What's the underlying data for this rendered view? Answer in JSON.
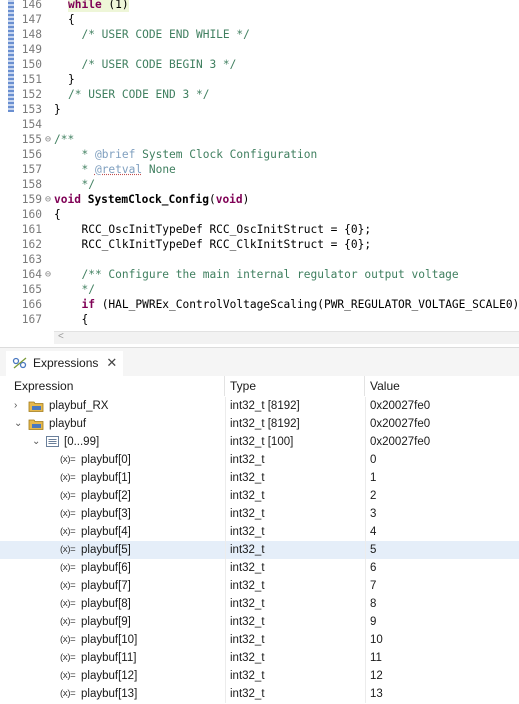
{
  "editor": {
    "lines": [
      {
        "n": "146",
        "fold": "",
        "segs": [
          [
            "kw",
            "while"
          ],
          [
            "pl",
            " (1)"
          ]
        ],
        "hl": true
      },
      {
        "n": "147",
        "fold": "",
        "segs": [
          [
            "pl",
            "{"
          ]
        ]
      },
      {
        "n": "148",
        "fold": "",
        "segs": [
          [
            "cm",
            "  /* USER CODE END WHILE */"
          ]
        ]
      },
      {
        "n": "149",
        "fold": "",
        "segs": []
      },
      {
        "n": "150",
        "fold": "",
        "segs": [
          [
            "cm",
            "  /* USER CODE BEGIN 3 */"
          ]
        ]
      },
      {
        "n": "151",
        "fold": "",
        "segs": [
          [
            "pl",
            "}"
          ]
        ]
      },
      {
        "n": "152",
        "fold": "",
        "segs": [
          [
            "cm",
            "/* USER CODE END 3 */"
          ]
        ]
      },
      {
        "n": "153",
        "fold": "",
        "segs": [
          [
            "pl",
            "}"
          ]
        ],
        "indent": -1
      },
      {
        "n": "154",
        "fold": "",
        "segs": []
      },
      {
        "n": "155",
        "fold": "⊖",
        "segs": [
          [
            "cm",
            "/**"
          ]
        ],
        "indent": -1
      },
      {
        "n": "156",
        "fold": "",
        "segs": [
          [
            "cm",
            "  * "
          ],
          [
            "tag",
            "@brief"
          ],
          [
            "cm",
            " System Clock Configuration"
          ]
        ]
      },
      {
        "n": "157",
        "fold": "",
        "segs": [
          [
            "cm",
            "  * "
          ],
          [
            "tagu",
            "@retval"
          ],
          [
            "cm",
            " None"
          ]
        ]
      },
      {
        "n": "158",
        "fold": "",
        "segs": [
          [
            "cm",
            "  */"
          ]
        ]
      },
      {
        "n": "159",
        "fold": "⊖",
        "segs": [
          [
            "kw",
            "void"
          ],
          [
            "pl",
            " "
          ],
          [
            "fn",
            "SystemClock_Config"
          ],
          [
            "pl",
            "("
          ],
          [
            "kw",
            "void"
          ],
          [
            "pl",
            ")"
          ]
        ],
        "indent": -1
      },
      {
        "n": "160",
        "fold": "",
        "segs": [
          [
            "pl",
            "{"
          ]
        ],
        "indent": -1
      },
      {
        "n": "161",
        "fold": "",
        "segs": [
          [
            "pl",
            "  RCC_OscInitTypeDef RCC_OscInitStruct = {0};"
          ]
        ]
      },
      {
        "n": "162",
        "fold": "",
        "segs": [
          [
            "pl",
            "  RCC_ClkInitTypeDef RCC_ClkInitStruct = {0};"
          ]
        ]
      },
      {
        "n": "163",
        "fold": "",
        "segs": []
      },
      {
        "n": "164",
        "fold": "⊖",
        "segs": [
          [
            "cm",
            "  /** Configure the main internal regulator output voltage"
          ]
        ]
      },
      {
        "n": "165",
        "fold": "",
        "segs": [
          [
            "cm",
            "  */"
          ]
        ]
      },
      {
        "n": "166",
        "fold": "",
        "segs": [
          [
            "kw",
            "  if"
          ],
          [
            "pl",
            " (HAL_PWREx_ControlVoltageScaling(PWR_REGULATOR_VOLTAGE_SCALE0)"
          ]
        ]
      },
      {
        "n": "167",
        "fold": "",
        "segs": [
          [
            "pl",
            "  {"
          ]
        ]
      }
    ],
    "hscroll_arrow": "<"
  },
  "view": {
    "tab_label": "Expressions",
    "close_glyph": "✕"
  },
  "table": {
    "headers": [
      "Expression",
      "Type",
      "Value"
    ],
    "rows": [
      {
        "level": 0,
        "chev": "›",
        "icon": "folder",
        "expr": "playbuf_RX",
        "type": "int32_t [8192]",
        "value": "0x20027fe0"
      },
      {
        "level": 0,
        "chev": "⌄",
        "icon": "folder",
        "expr": "playbuf",
        "type": "int32_t [8192]",
        "value": "0x20027fe0"
      },
      {
        "level": 1,
        "chev": "⌄",
        "icon": "array",
        "expr": "[0...99]",
        "type": "int32_t [100]",
        "value": "0x20027fe0"
      },
      {
        "level": 2,
        "icon": "var",
        "expr": "playbuf[0]",
        "type": "int32_t",
        "value": "0"
      },
      {
        "level": 2,
        "icon": "var",
        "expr": "playbuf[1]",
        "type": "int32_t",
        "value": "1"
      },
      {
        "level": 2,
        "icon": "var",
        "expr": "playbuf[2]",
        "type": "int32_t",
        "value": "2"
      },
      {
        "level": 2,
        "icon": "var",
        "expr": "playbuf[3]",
        "type": "int32_t",
        "value": "3"
      },
      {
        "level": 2,
        "icon": "var",
        "expr": "playbuf[4]",
        "type": "int32_t",
        "value": "4"
      },
      {
        "level": 2,
        "icon": "var",
        "expr": "playbuf[5]",
        "type": "int32_t",
        "value": "5",
        "selected": true
      },
      {
        "level": 2,
        "icon": "var",
        "expr": "playbuf[6]",
        "type": "int32_t",
        "value": "6"
      },
      {
        "level": 2,
        "icon": "var",
        "expr": "playbuf[7]",
        "type": "int32_t",
        "value": "7"
      },
      {
        "level": 2,
        "icon": "var",
        "expr": "playbuf[8]",
        "type": "int32_t",
        "value": "8"
      },
      {
        "level": 2,
        "icon": "var",
        "expr": "playbuf[9]",
        "type": "int32_t",
        "value": "9"
      },
      {
        "level": 2,
        "icon": "var",
        "expr": "playbuf[10]",
        "type": "int32_t",
        "value": "10"
      },
      {
        "level": 2,
        "icon": "var",
        "expr": "playbuf[11]",
        "type": "int32_t",
        "value": "11"
      },
      {
        "level": 2,
        "icon": "var",
        "expr": "playbuf[12]",
        "type": "int32_t",
        "value": "12"
      },
      {
        "level": 2,
        "icon": "var",
        "expr": "playbuf[13]",
        "type": "int32_t",
        "value": "13"
      }
    ],
    "var_icon_glyph": "(x)="
  }
}
